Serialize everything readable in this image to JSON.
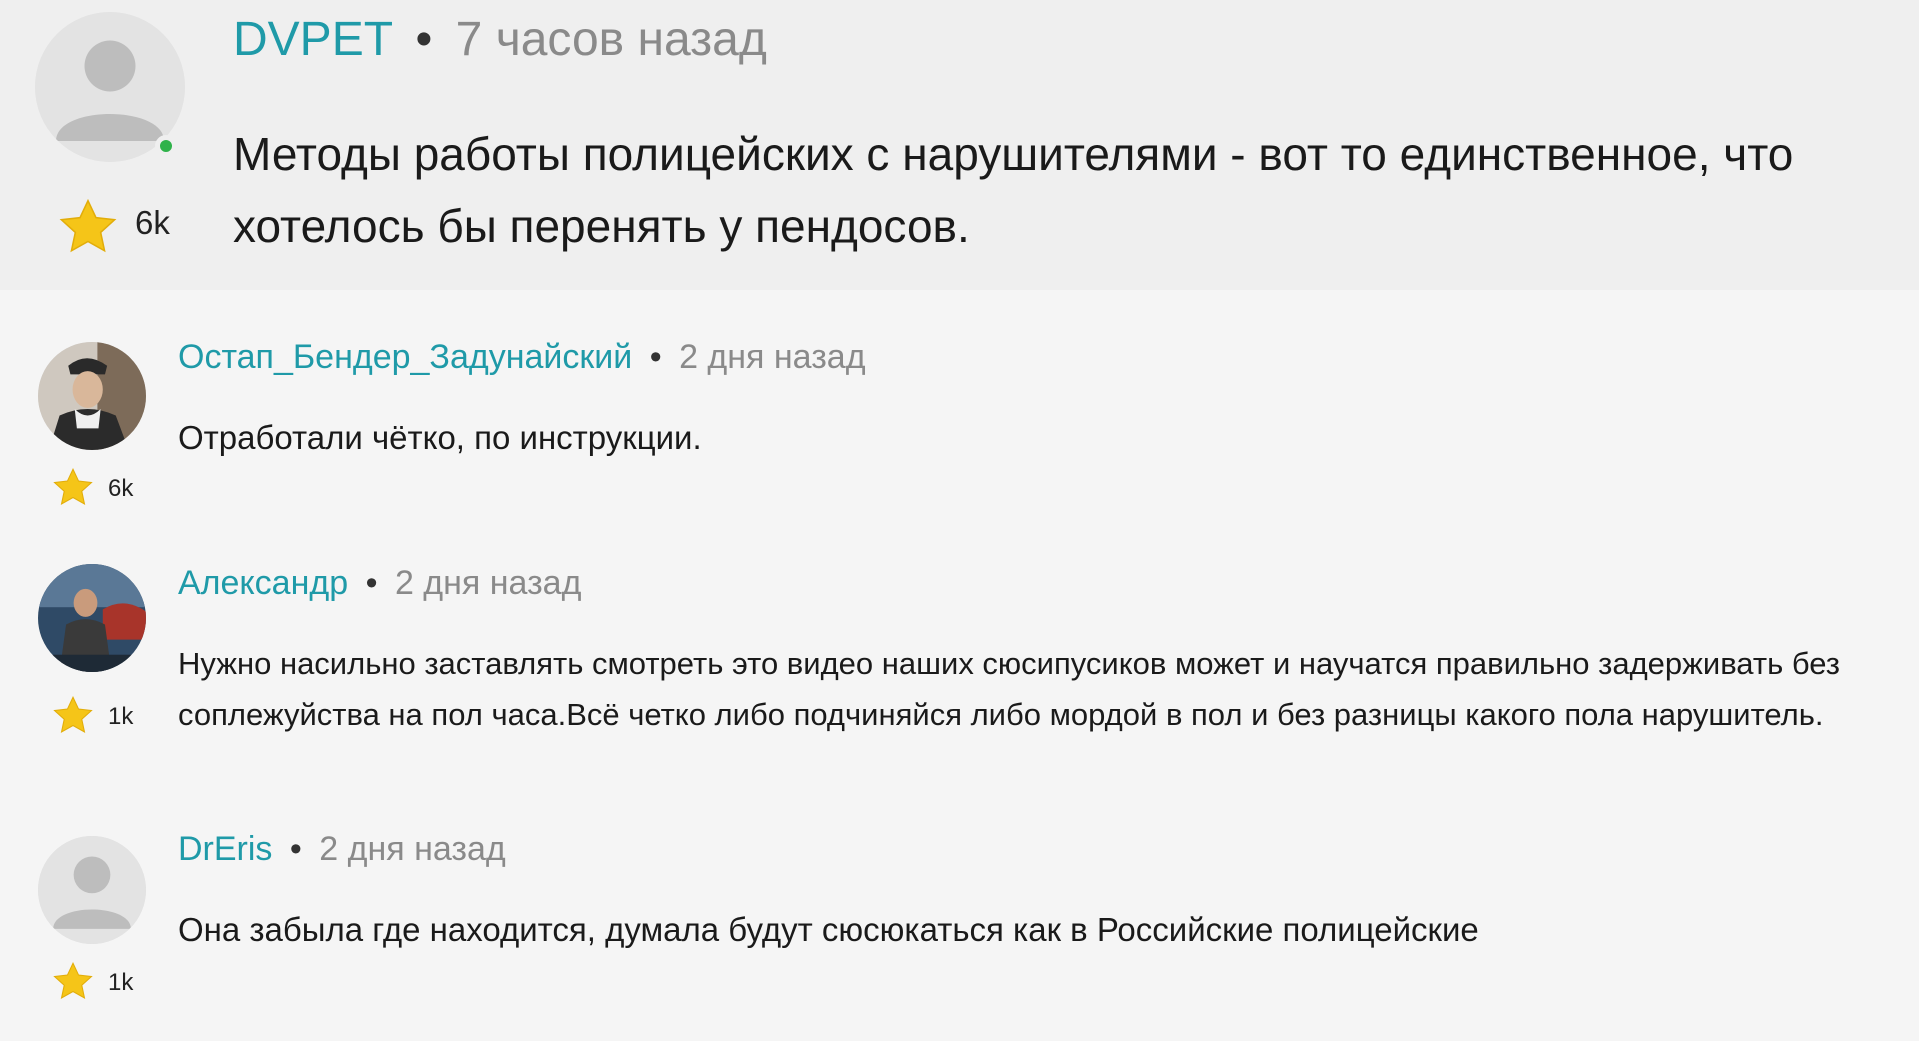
{
  "comments": [
    {
      "author": "DVPET",
      "separator": "•",
      "time": "7 часов назад",
      "rating": "6k",
      "avatar_icon": "default-user-icon",
      "online": true,
      "text": "Методы работы полицейских с нарушителями - вот то единственное, что хотелось бы перенять у пендосов."
    },
    {
      "author": "Остап_Бендер_Задунайский",
      "separator": "•",
      "time": "2 дня назад",
      "rating": "6k",
      "avatar_icon": "user-photo-avatar",
      "text": "Отработали чётко, по инструкции."
    },
    {
      "author": "Александр",
      "separator": "•",
      "time": "2 дня назад",
      "rating": "1k",
      "avatar_icon": "user-photo-avatar",
      "text": "Нужно насильно заставлять смотреть это видео наших сюсипусиков может и научатся правильно задерживать без соплежуйства на пол часа.Всё четко либо подчиняйся либо мордой в пол и без разницы какого пола нарушитель."
    },
    {
      "author": "DrEris",
      "separator": "•",
      "time": "2 дня назад",
      "rating": "1k",
      "avatar_icon": "default-user-icon",
      "text": "Она забыла где находится, думала будут сюсюкаться как в Российские полицейские"
    }
  ],
  "colors": {
    "author_link": "#1f9aa8",
    "time_text": "#8a8a8a",
    "star": "#f5c518",
    "online": "#2fb24a",
    "top_background": "#efefef",
    "page_background": "#f5f5f5"
  }
}
